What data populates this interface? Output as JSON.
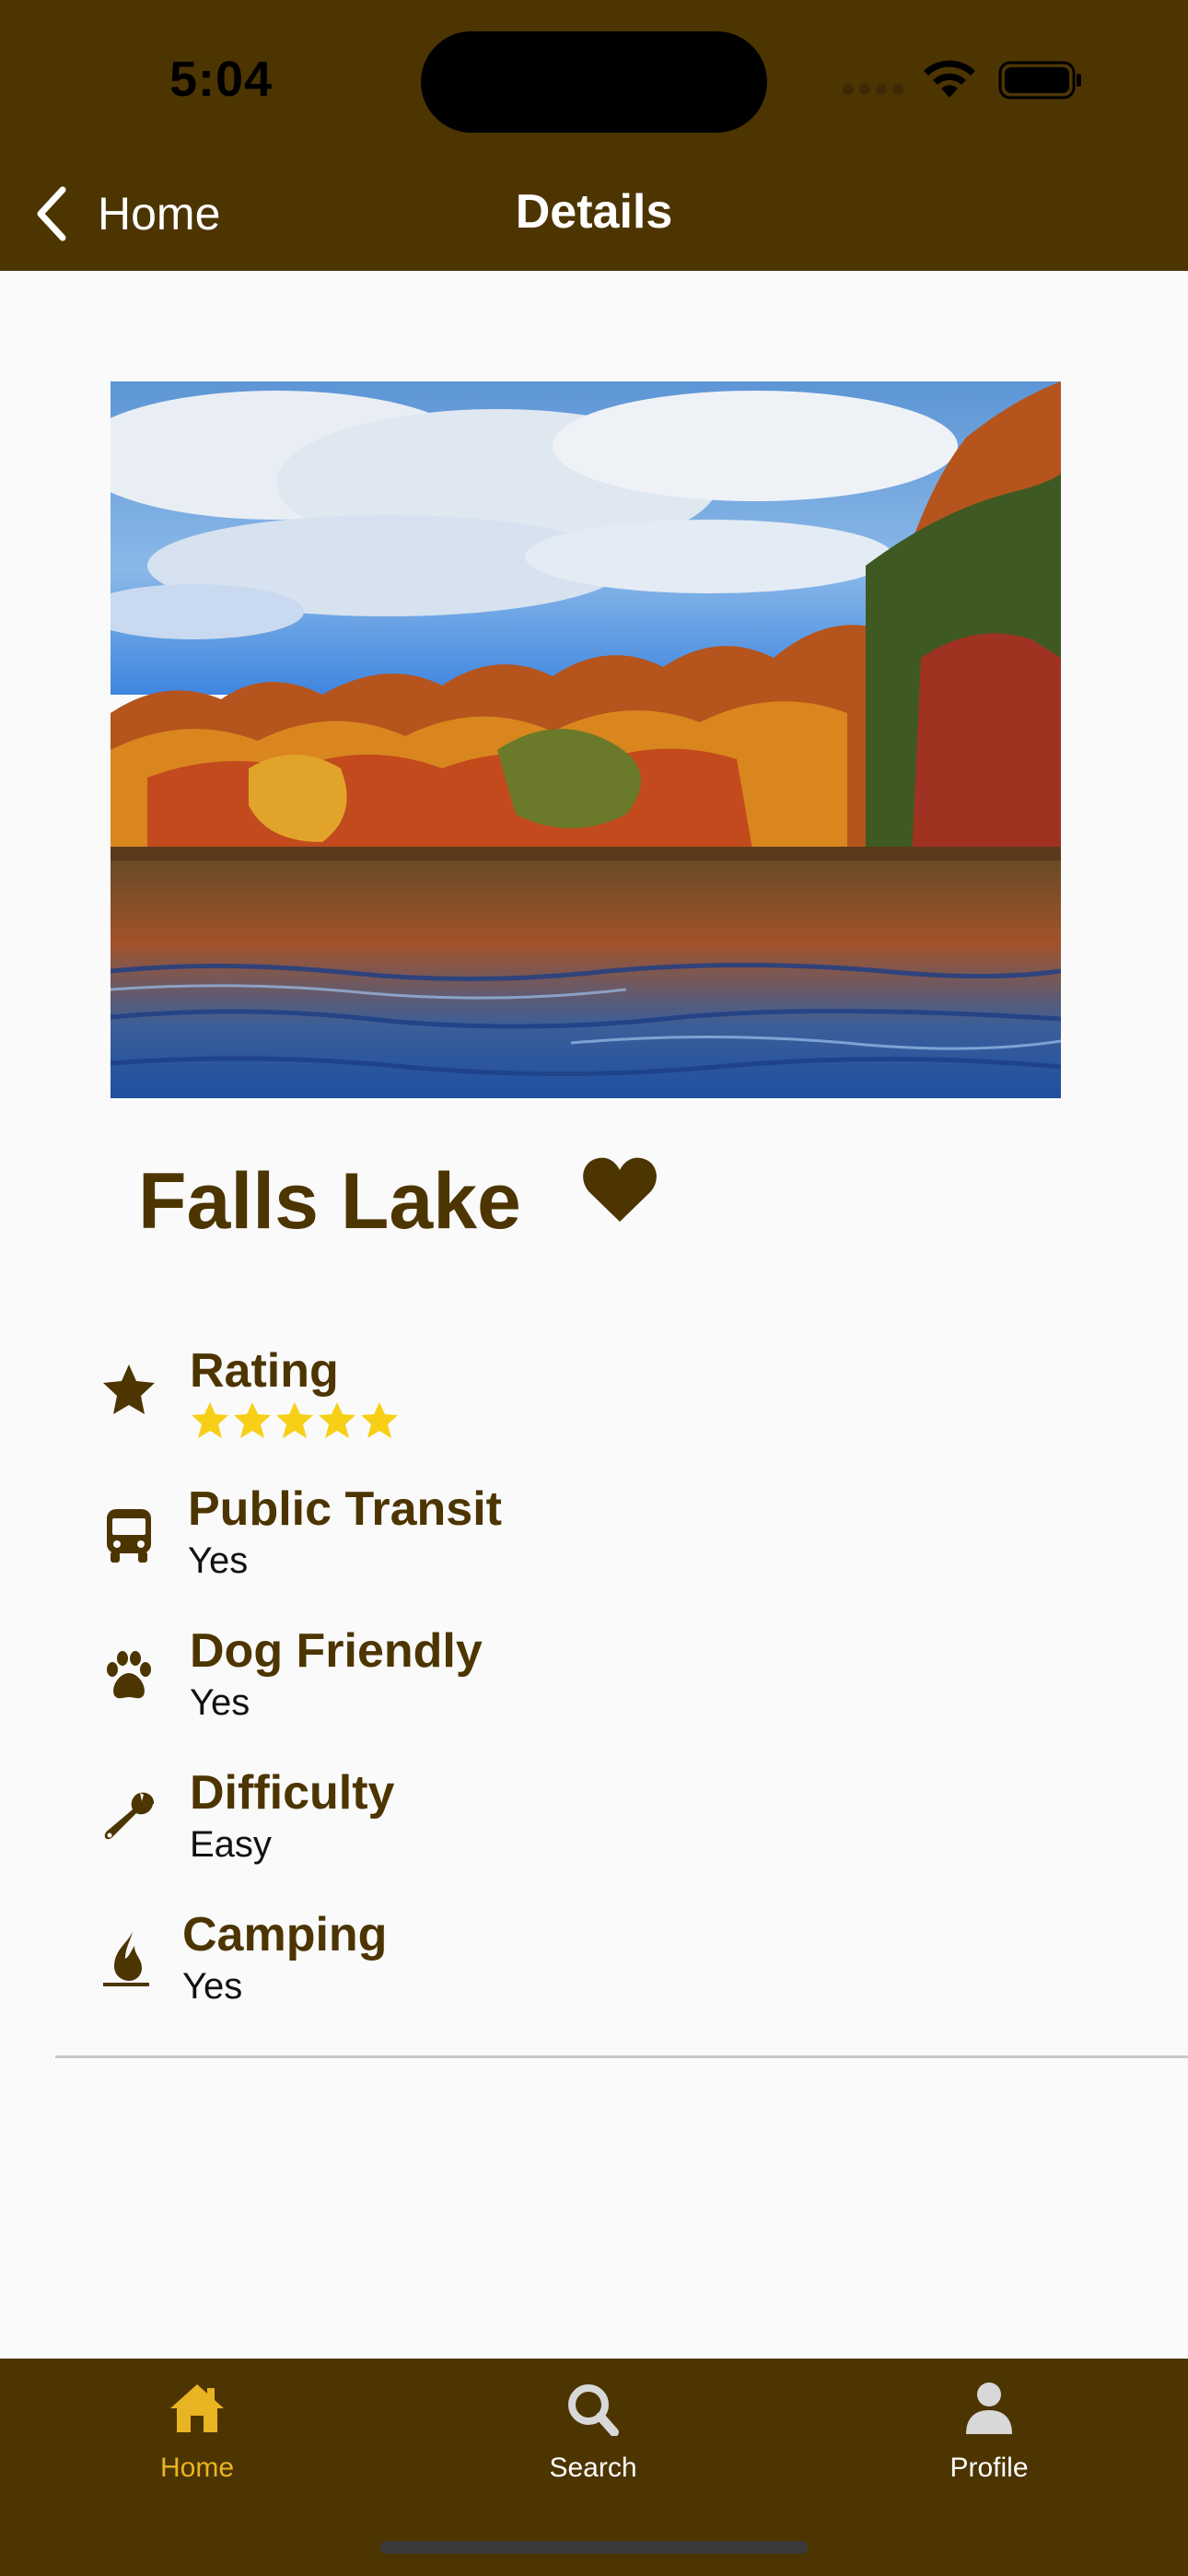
{
  "status_bar": {
    "time": "5:04"
  },
  "nav": {
    "back_label": "Home",
    "title": "Details"
  },
  "place": {
    "name": "Falls Lake",
    "favorited": true
  },
  "details": {
    "rating": {
      "label": "Rating",
      "stars": 5,
      "max_stars": 5
    },
    "public_transit": {
      "label": "Public Transit",
      "value": "Yes"
    },
    "dog_friendly": {
      "label": "Dog Friendly",
      "value": "Yes"
    },
    "difficulty": {
      "label": "Difficulty",
      "value": "Easy"
    },
    "camping": {
      "label": "Camping",
      "value": "Yes"
    }
  },
  "tabs": [
    {
      "label": "Home",
      "icon": "home-icon",
      "active": true
    },
    {
      "label": "Search",
      "icon": "search-icon",
      "active": false
    },
    {
      "label": "Profile",
      "icon": "person-icon",
      "active": false
    }
  ],
  "colors": {
    "brand_brown": "#4d3502",
    "tab_active": "#e8b422",
    "star_gold": "#f7cf17",
    "background": "#fafafa"
  }
}
